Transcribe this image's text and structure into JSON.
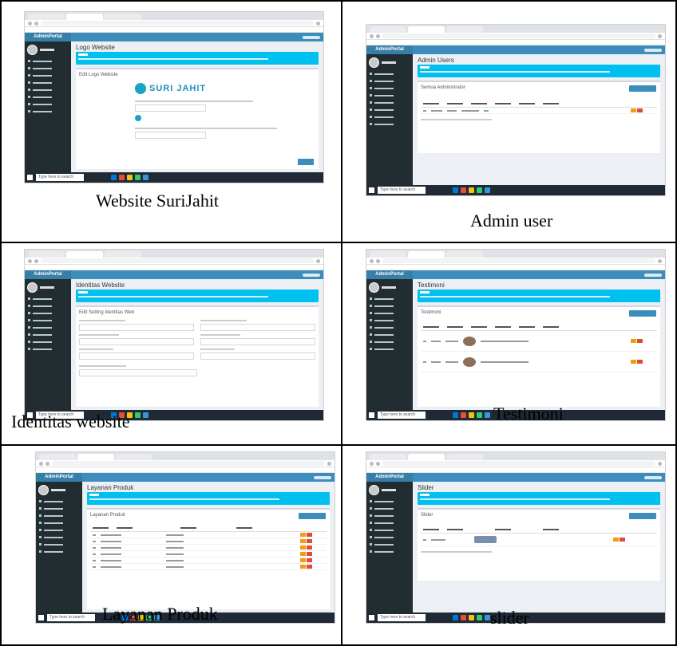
{
  "captions": {
    "c1": "Website SuriJahit",
    "c2": "Admin user",
    "c3": "Identitas website",
    "c4": "Testimoni",
    "c5": "Layanan Produk",
    "c6": "slider"
  },
  "shots": {
    "s1": {
      "brand": "AdminPortal",
      "title": "Logo Website",
      "box_title": "Edit Logo Website",
      "logo_text": "SURI JAHIT",
      "taskbar_search": "Type here to search"
    },
    "s2": {
      "brand": "AdminPortal",
      "title": "Admin Users",
      "box_title": "Semua Administrator",
      "taskbar_search": "Type here to search"
    },
    "s3": {
      "brand": "AdminPortal",
      "title": "Identitas Website",
      "box_title": "Edit Setting Identitas Web",
      "taskbar_search": "Type here to search"
    },
    "s4": {
      "brand": "AdminPortal",
      "title": "Testimoni",
      "box_title": "Testimoni",
      "taskbar_search": "Type here to search"
    },
    "s5": {
      "brand": "AdminPortal",
      "title": "Layanan Produk",
      "box_title": "Layanan Produk",
      "taskbar_search": "Type here to search"
    },
    "s6": {
      "brand": "AdminPortal",
      "title": "Slider",
      "box_title": "Slider",
      "taskbar_search": "Type here to search"
    }
  }
}
